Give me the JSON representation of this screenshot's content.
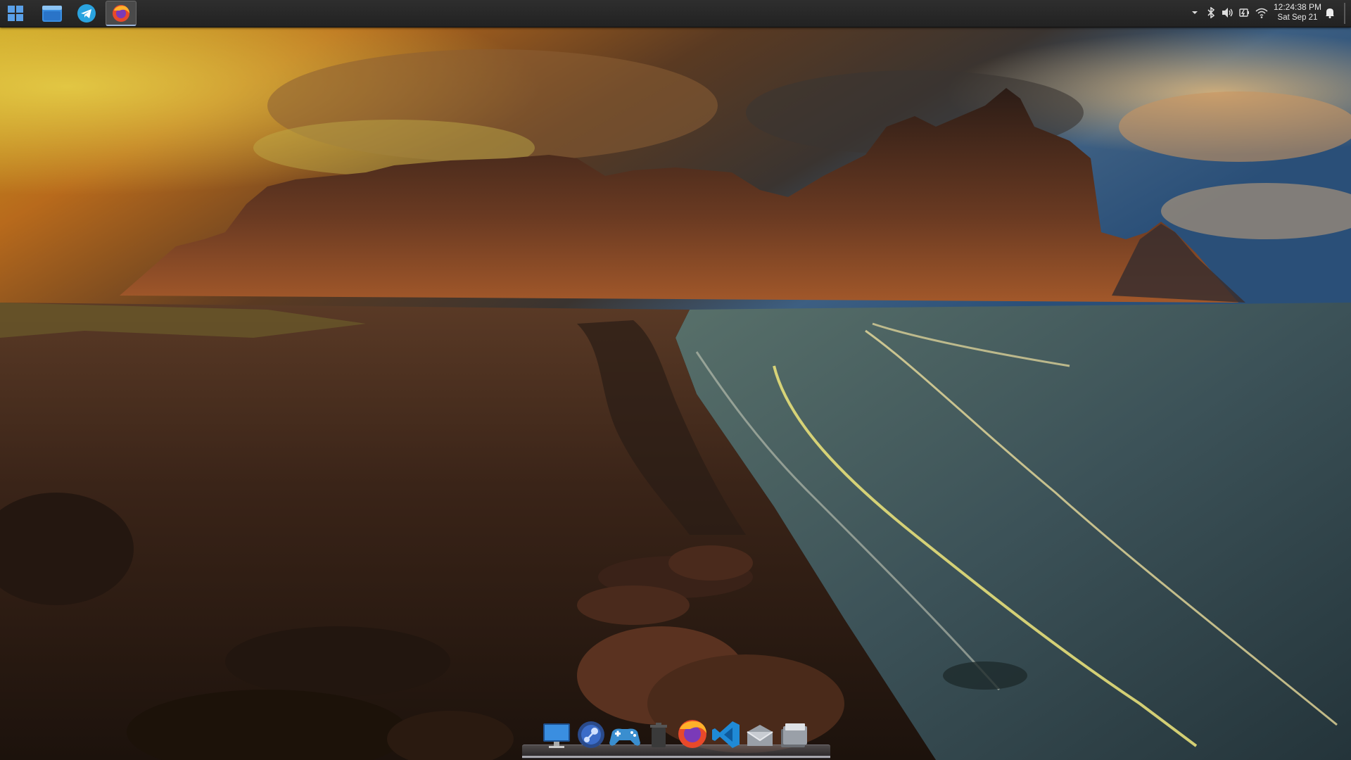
{
  "panel": {
    "launchers": [
      {
        "name": "start-menu",
        "icon": "windows-icon"
      },
      {
        "name": "file-manager",
        "icon": "folder-icon"
      },
      {
        "name": "telegram",
        "icon": "telegram-icon"
      },
      {
        "name": "firefox",
        "icon": "firefox-icon",
        "active": true
      }
    ],
    "tray": {
      "icons": [
        "tray-expand-icon",
        "bluetooth-icon",
        "volume-icon",
        "power-icon",
        "wifi-icon",
        "notification-bell-icon"
      ]
    },
    "clock": {
      "time": "12:24:38 PM",
      "date": "Sat Sep 21"
    }
  },
  "dock": {
    "items": [
      {
        "name": "dock-desktop",
        "icon": "monitor-icon"
      },
      {
        "name": "dock-steam",
        "icon": "steam-icon"
      },
      {
        "name": "dock-games",
        "icon": "gamepad-icon"
      },
      {
        "name": "dock-trash",
        "icon": "trash-icon"
      },
      {
        "name": "dock-firefox",
        "icon": "firefox-icon"
      },
      {
        "name": "dock-vscode",
        "icon": "vscode-icon"
      },
      {
        "name": "dock-mail",
        "icon": "mail-icon"
      },
      {
        "name": "dock-files",
        "icon": "file-stack-icon"
      }
    ]
  },
  "colors": {
    "panel_bg": "#262626",
    "panel_text": "#e8e8e8",
    "sky_warm": "#d89a2a",
    "sky_cool": "#2f5c86",
    "mountain": "#4a2d20",
    "sand": "#3a2418",
    "sea": "#3c5258"
  }
}
